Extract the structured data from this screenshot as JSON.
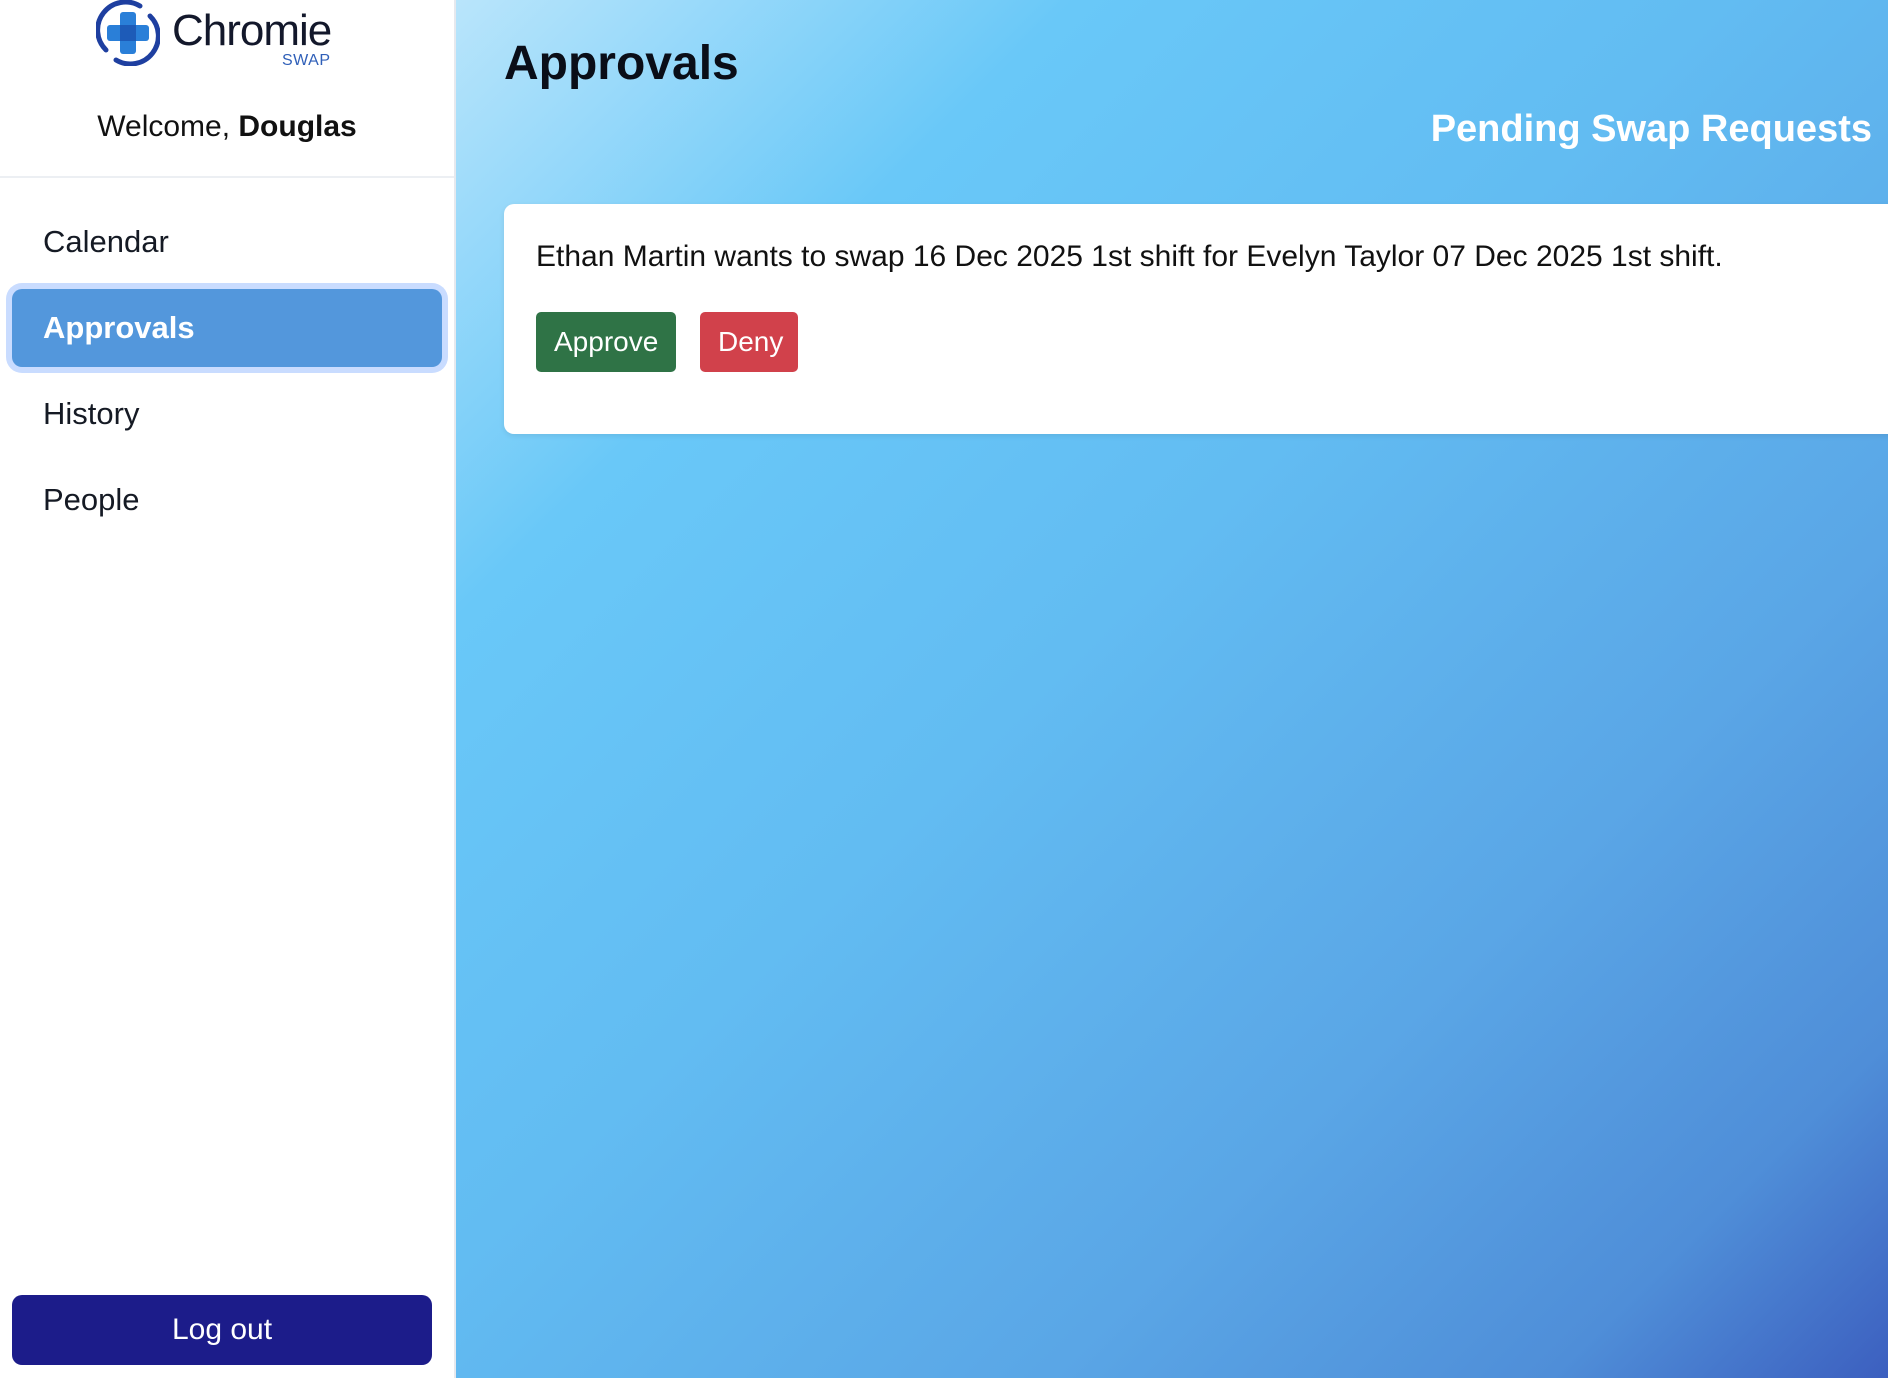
{
  "brand": {
    "name": "Chromie",
    "sub": "SWAP"
  },
  "user": {
    "welcome_prefix": "Welcome, ",
    "name": "Douglas"
  },
  "nav": {
    "items": [
      {
        "label": "Calendar",
        "active": false
      },
      {
        "label": "Approvals",
        "active": true
      },
      {
        "label": "History",
        "active": false
      },
      {
        "label": "People",
        "active": false
      }
    ]
  },
  "logout_label": "Log out",
  "main": {
    "title": "Approvals",
    "section_title": "Pending Swap Requests",
    "requests": [
      {
        "text": "Ethan Martin wants to swap 16 Dec 2025 1st shift for Evelyn Taylor 07 Dec 2025 1st shift.",
        "approve_label": "Approve",
        "deny_label": "Deny"
      }
    ]
  },
  "colors": {
    "active_nav": "#5397dc",
    "logout": "#1c1c8a",
    "approve": "#2f7346",
    "deny": "#d1414b"
  }
}
